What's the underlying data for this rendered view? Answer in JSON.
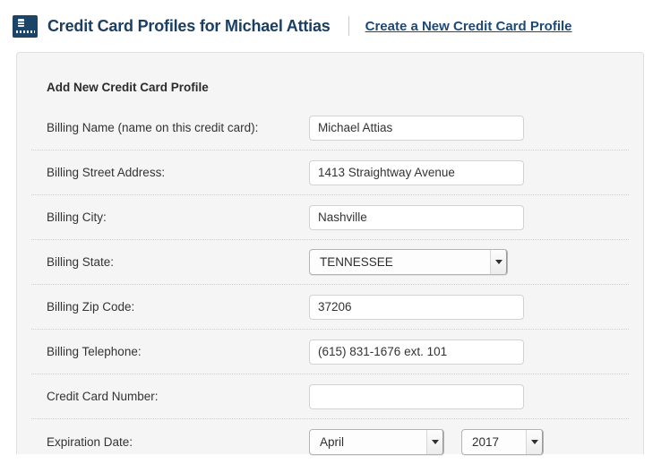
{
  "header": {
    "icon": "credit-card-icon",
    "title": "Credit Card Profiles for Michael Attias",
    "link_label": "Create a New Credit Card Profile"
  },
  "panel": {
    "title": "Add New Credit Card Profile",
    "rows": [
      {
        "label": "Billing Name (name on this credit card):",
        "type": "text",
        "value": "Michael Attias",
        "placeholder": "",
        "name": "billing-name"
      },
      {
        "label": "Billing Street Address:",
        "type": "text",
        "value": "1413 Straightway Avenue",
        "placeholder": "",
        "name": "billing-street-address"
      },
      {
        "label": "Billing City:",
        "type": "text",
        "value": "Nashville",
        "placeholder": "",
        "name": "billing-city"
      },
      {
        "label": "Billing State:",
        "type": "select",
        "value": "TENNESSEE",
        "name": "billing-state"
      },
      {
        "label": "Billing Zip Code:",
        "type": "text",
        "value": "37206",
        "placeholder": "",
        "name": "billing-zip-code"
      },
      {
        "label": "Billing Telephone:",
        "type": "text",
        "value": "(615) 831-1676 ext. 101",
        "placeholder": "",
        "name": "billing-telephone"
      },
      {
        "label": "Credit Card Number:",
        "type": "text",
        "value": "",
        "placeholder": "",
        "name": "credit-card-number"
      },
      {
        "label": "Expiration Date:",
        "type": "date-selects",
        "month": "April",
        "year": "2017",
        "name": "expiration-date"
      }
    ]
  },
  "colors": {
    "brand_navy": "#1b3f63",
    "link_navy": "#1b4a7a",
    "icon_navy": "#1b4469",
    "panel_bg": "#f5f5f5",
    "panel_border": "#e0e0e0",
    "input_border": "#d3d3d3",
    "divider": "#cfcfcf"
  }
}
